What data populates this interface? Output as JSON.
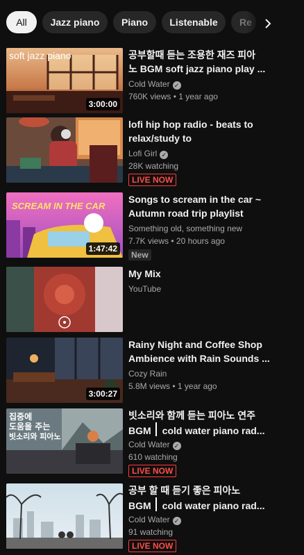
{
  "chips": [
    {
      "label": "All",
      "active": true
    },
    {
      "label": "Jazz piano",
      "active": false
    },
    {
      "label": "Piano",
      "active": false
    },
    {
      "label": "Listenable",
      "active": false
    },
    {
      "label": "Re",
      "active": false
    }
  ],
  "chips_next_icon": "chevron-right-icon",
  "videos": [
    {
      "title_line1": "공부할때 듣는 조용한 재즈 피아",
      "title_line2": "노 BGM soft jazz piano play ...",
      "channel": "Cold Water",
      "verified": true,
      "stats": "760K views • 1 year ago",
      "duration": "3:00:00",
      "thumb_text": "soft jazz piano"
    },
    {
      "title_line1": "lofi hip hop radio - beats to",
      "title_line2": "relax/study to",
      "channel": "Lofi Girl",
      "verified": true,
      "stats": "28K watching",
      "live": "LIVE NOW"
    },
    {
      "title_line1": "Songs to scream in the car ~",
      "title_line2": "Autumn road trip playlist",
      "channel": "Something old, something new",
      "verified": false,
      "stats": "7.7K views • 20 hours ago",
      "duration": "1:47:42",
      "badge": "New",
      "thumb_text": "SCREAM IN THE CAR"
    },
    {
      "title_line1": "My Mix",
      "title_line2": "",
      "channel": "YouTube",
      "verified": false,
      "stats": ""
    },
    {
      "title_line1": "Rainy Night and Coffee Shop",
      "title_line2": "Ambience with Rain Sounds ...",
      "channel": "Cozy Rain",
      "verified": false,
      "stats": "5.8M views • 1 year ago",
      "duration": "3:00:27"
    },
    {
      "title_line1": "빗소리와 함께 듣는 피아노 연주",
      "title_line2a": "BGM",
      "title_line2b": "cold water piano rad...",
      "channel": "Cold Water",
      "verified": true,
      "stats": "610 watching",
      "live": "LIVE NOW",
      "thumb_text_1": "집중에",
      "thumb_text_2": "도움을 주는",
      "thumb_text_3": "빗소리와 피아노"
    },
    {
      "title_line1": "공부 할 때 듣기 좋은 피아노",
      "title_line2a": "BGM",
      "title_line2b": "cold water piano rad...",
      "channel": "Cold Water",
      "verified": true,
      "stats": "91 watching",
      "live": "LIVE NOW"
    }
  ],
  "colors": {
    "background": "#0f0f0f",
    "chip_bg": "#272727",
    "chip_active_bg": "#f1f1f1",
    "live_red": "#ff4e45"
  }
}
